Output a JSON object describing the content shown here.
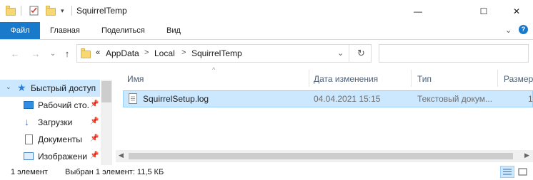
{
  "window": {
    "title": "SquirrelTemp",
    "minimize": "—",
    "maximize": "☐",
    "close": "✕"
  },
  "ribbon": {
    "tabs": [
      {
        "label": "Файл"
      },
      {
        "label": "Главная"
      },
      {
        "label": "Поделиться"
      },
      {
        "label": "Вид"
      }
    ]
  },
  "nav": {
    "back": "←",
    "forward": "→",
    "recent": "⌄",
    "up": "↑",
    "overflow": "«",
    "breadcrumbs": [
      "AppData",
      "Local",
      "SquirrelTemp"
    ],
    "dropdown": "⌄",
    "refresh": "↻",
    "search_placeholder": ""
  },
  "sidebar": {
    "items": [
      {
        "label": "Быстрый доступ",
        "icon": "star-icon"
      },
      {
        "label": "Рабочий сто.",
        "icon": "desktop-icon",
        "pinned": "📌"
      },
      {
        "label": "Загрузки",
        "icon": "download-icon",
        "pinned": "📌"
      },
      {
        "label": "Документы",
        "icon": "document-icon",
        "pinned": "📌"
      },
      {
        "label": "Изображени",
        "icon": "pictures-icon",
        "pinned": "📌"
      }
    ]
  },
  "list": {
    "columns": [
      "Имя",
      "Дата изменения",
      "Тип",
      "Размер"
    ],
    "sort_indicator": "^",
    "rows": [
      {
        "name": "SquirrelSetup.log",
        "modified": "04.04.2021 15:15",
        "type": "Текстовый докум...",
        "size": "1"
      }
    ]
  },
  "status": {
    "count": "1 элемент",
    "selection": "Выбран 1 элемент: 11,5 КБ"
  },
  "colors": {
    "accent": "#1979ca",
    "selection": "#cce8ff",
    "selection_border": "#99d1ff"
  }
}
